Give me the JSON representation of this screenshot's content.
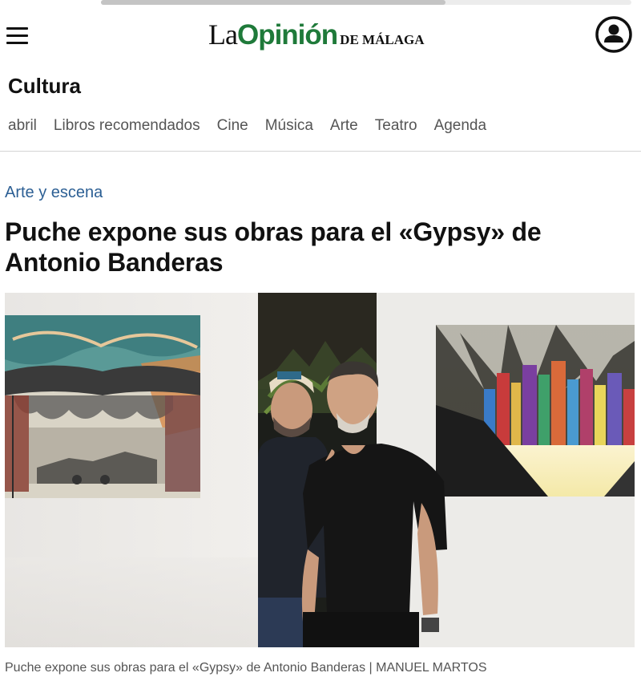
{
  "header": {
    "logo_la": "La",
    "logo_opinion": "Opinión",
    "logo_malaga": "DE MÁLAGA",
    "menu_icon": "hamburger-menu-icon",
    "user_icon": "user-account-icon"
  },
  "section": {
    "title": "Cultura"
  },
  "subnav": {
    "items": [
      "abril",
      "Libros recomendados",
      "Cine",
      "Música",
      "Arte",
      "Teatro",
      "Agenda"
    ]
  },
  "article": {
    "category": "Arte y escena",
    "headline": "Puche expone sus obras para el «Gypsy» de Antonio Banderas",
    "image_caption": "Puche expone sus obras para el «Gypsy» de Antonio Banderas | MANUEL MARTOS"
  },
  "colors": {
    "brand_green": "#1f7a3a",
    "category_blue": "#2c5f94",
    "text": "#111111",
    "muted_text": "#555555"
  }
}
